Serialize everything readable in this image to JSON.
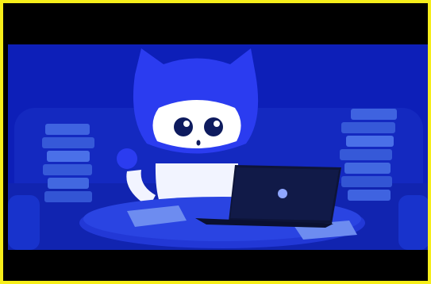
{
  "image": {
    "kind": "video-frame",
    "subject": "mascot-cat-with-laptop",
    "colors": {
      "border": "#f6ee1a",
      "letterbox": "#000000",
      "background": "#0d1fb8",
      "sofa": "#1732c8",
      "mascot": "#2b3cf0",
      "table": "#2438d8",
      "laptop": "#0d1438"
    }
  }
}
